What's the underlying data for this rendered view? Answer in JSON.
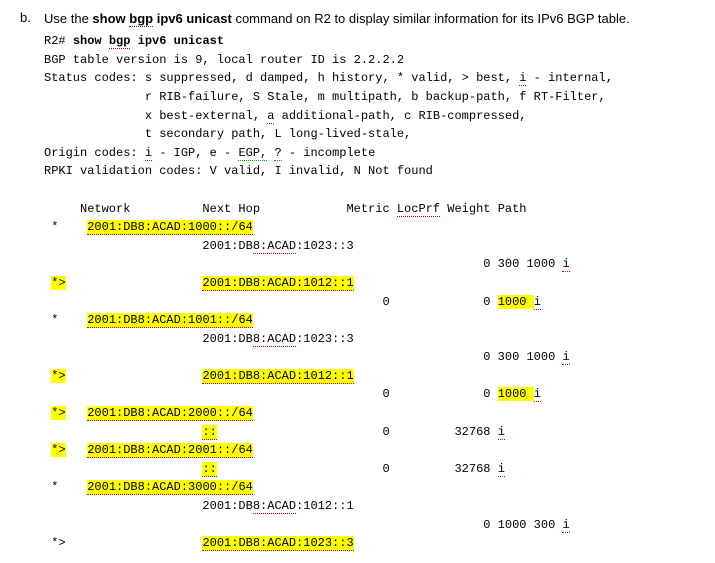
{
  "bullet": "b.",
  "lead_parts": {
    "p1": "Use the ",
    "cmd1_a": "show ",
    "cmd1_b": "bgp",
    "cmd1_c": " ipv6 unicast",
    "p2": " command on R2 to display similar information for its IPv6 BGP table."
  },
  "prompt_parts": {
    "host": "R2# ",
    "kw1": "show ",
    "kw2": "bgp",
    "kw3": " ipv6 unicast"
  },
  "lines": {
    "l1": "BGP table version is 9, local router ID is 2.2.2.2",
    "l2a": "Status codes: s suppressed, d damped, h history, * valid, > best, ",
    "l2b": "i",
    "l2c": " - internal,",
    "l3": "              r RIB-failure, S Stale, m multipath, b backup-path, f RT-Filter,",
    "l4a": "              x best-external, ",
    "l4b": "a",
    "l4c": " additional-path, c RIB-compressed,",
    "l5": "              t secondary path, L long-lived-stale,",
    "l6a": "Origin codes: ",
    "l6b": "i",
    "l6c": " - IGP, e - ",
    "l6d": "EGP,",
    "l6e": " ",
    "l6f": "?",
    "l6g": " - incomplete",
    "l7": "RPKI validation codes: V valid, I invalid, N Not found",
    "hdr_a": "     Network          Next Hop            Metric ",
    "hdr_b": "LocPrf",
    "hdr_c": " Weight Path",
    "r1a": " *    ",
    "r1b": "2001:DB8:ACAD:1000::/64",
    "r2a": "                      2001:DB",
    "r2b": "8:ACAD",
    "r2c": ":1023::3",
    "r3a": "                                                             0 300 1000 ",
    "r3b": "i",
    "r4a": " ",
    "r4b": "*>",
    "r4c": "                   ",
    "r4d": "2001:DB8:ACAD:1012::1",
    "r5a": "                                               0             0 ",
    "r5b": "1000 ",
    "r5c": "i",
    "r6a": " *    ",
    "r6b": "2001:DB8:ACAD:1001::/64",
    "r7a": "                      2001:DB",
    "r7b": "8:ACAD",
    "r7c": ":1023::3",
    "r8a": "                                                             0 300 1000 ",
    "r8b": "i",
    "r9a": " ",
    "r9b": "*>",
    "r9c": "                   ",
    "r9d": "2001:DB8:ACAD:1012::1",
    "r10a": "                                               0             0 ",
    "r10b": "1000 ",
    "r10c": "i",
    "r11a": " ",
    "r11b": "*>",
    "r11c": "   ",
    "r11d": "2001:DB8:ACAD:2000::/64",
    "r12a": "                      ",
    "r12b": "::",
    "r12c": "                       0         32768 ",
    "r12d": "i",
    "r13a": " ",
    "r13b": "*>",
    "r13c": "   ",
    "r13d": "2001:DB8:ACAD:2001::/64",
    "r14a": "                      ",
    "r14b": "::",
    "r14c": "                       0         32768 ",
    "r14d": "i",
    "r15a": " *    ",
    "r15b": "2001:DB8:ACAD:3000::/64",
    "r16a": "                      2001:DB",
    "r16b": "8:ACAD",
    "r16c": ":1012::1",
    "r17a": "                                                             0 1000 300 ",
    "r17b": "i",
    "r18a": " *>                   ",
    "r18b": "2001:DB8:ACAD:1023::3"
  },
  "chart_data": {
    "type": "table",
    "title": "show bgp ipv6 unicast (R2)",
    "router_id": "2.2.2.2",
    "table_version": 9,
    "columns": [
      "Status",
      "Network",
      "Next Hop",
      "Metric",
      "LocPrf",
      "Weight",
      "Path"
    ],
    "rows": [
      {
        "Status": "*",
        "Network": "2001:DB8:ACAD:1000::/64",
        "Next Hop": "2001:DB8:ACAD:1023::3",
        "Metric": null,
        "LocPrf": null,
        "Weight": 0,
        "Path": "300 1000 i"
      },
      {
        "Status": "*>",
        "Network": "2001:DB8:ACAD:1000::/64",
        "Next Hop": "2001:DB8:ACAD:1012::1",
        "Metric": 0,
        "LocPrf": null,
        "Weight": 0,
        "Path": "1000 i"
      },
      {
        "Status": "*",
        "Network": "2001:DB8:ACAD:1001::/64",
        "Next Hop": "2001:DB8:ACAD:1023::3",
        "Metric": null,
        "LocPrf": null,
        "Weight": 0,
        "Path": "300 1000 i"
      },
      {
        "Status": "*>",
        "Network": "2001:DB8:ACAD:1001::/64",
        "Next Hop": "2001:DB8:ACAD:1012::1",
        "Metric": 0,
        "LocPrf": null,
        "Weight": 0,
        "Path": "1000 i"
      },
      {
        "Status": "*>",
        "Network": "2001:DB8:ACAD:2000::/64",
        "Next Hop": "::",
        "Metric": 0,
        "LocPrf": null,
        "Weight": 32768,
        "Path": "i"
      },
      {
        "Status": "*>",
        "Network": "2001:DB8:ACAD:2001::/64",
        "Next Hop": "::",
        "Metric": 0,
        "LocPrf": null,
        "Weight": 32768,
        "Path": "i"
      },
      {
        "Status": "*",
        "Network": "2001:DB8:ACAD:3000::/64",
        "Next Hop": "2001:DB8:ACAD:1012::1",
        "Metric": null,
        "LocPrf": null,
        "Weight": 0,
        "Path": "1000 300 i"
      },
      {
        "Status": "*>",
        "Network": "2001:DB8:ACAD:3000::/64",
        "Next Hop": "2001:DB8:ACAD:1023::3",
        "Metric": null,
        "LocPrf": null,
        "Weight": null,
        "Path": null
      }
    ]
  }
}
